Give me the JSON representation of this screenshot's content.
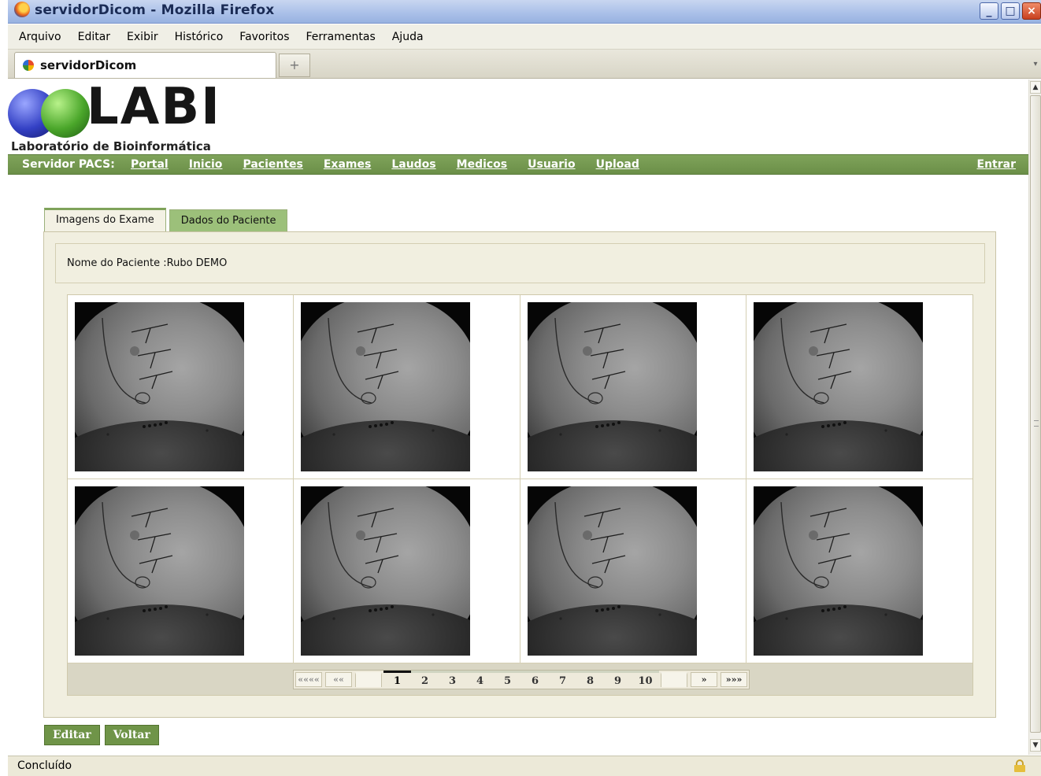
{
  "window": {
    "title": "servidorDicom - Mozilla Firefox",
    "buttons": [
      "minimize",
      "maximize",
      "close"
    ]
  },
  "menubar": {
    "items": [
      "Arquivo",
      "Editar",
      "Exibir",
      "Histórico",
      "Favoritos",
      "Ferramentas",
      "Ajuda"
    ]
  },
  "browser_tab": {
    "label": "servidorDicom",
    "new_tab": "+"
  },
  "logo": {
    "word": "LABI",
    "subtitle": "Laboratório de Bioinformática"
  },
  "nav": {
    "brand": "Servidor PACS:",
    "links": [
      "Portal",
      "Inicio",
      "Pacientes",
      "Exames",
      "Laudos",
      "Medicos",
      "Usuario",
      "Upload"
    ],
    "login": "Entrar"
  },
  "page_tabs": {
    "active": "Imagens do Exame",
    "inactive": "Dados do Paciente"
  },
  "patient": {
    "label": "Nome do Paciente :",
    "name": "Rubo DEMO"
  },
  "images": {
    "count": 8
  },
  "pager": {
    "first": "««««",
    "prev": "««",
    "pages": [
      "1",
      "2",
      "3",
      "4",
      "5",
      "6",
      "7",
      "8",
      "9",
      "10"
    ],
    "current": "1",
    "next": "»",
    "last": "»»»"
  },
  "actions": {
    "edit": "Editar",
    "back": "Voltar"
  },
  "status": {
    "text": "Concluído"
  }
}
